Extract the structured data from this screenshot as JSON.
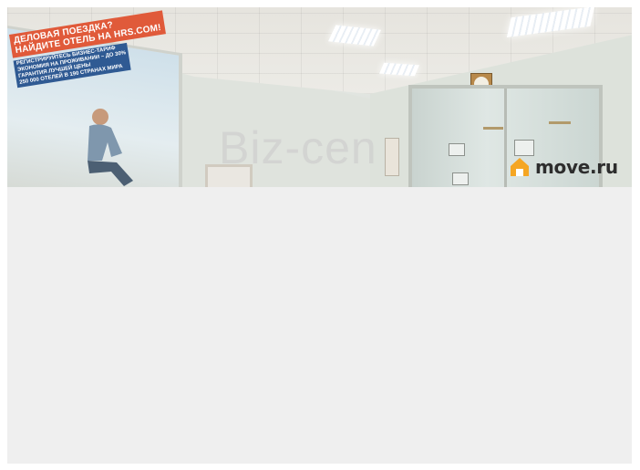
{
  "photo": {
    "poster": {
      "headline_lines": [
        "ДЕЛОВАЯ ПОЕЗДКА?",
        "НАЙДИТЕ ОТЕЛЬ НА HRS.COM!"
      ],
      "bullets": [
        "РЕГИСТРИРУЙТЕСЬ БИЗНЕС-ТАРИФ",
        "ЭКОНОМИЯ НА ПРОЖИВАНИИ – ДО 30%",
        "ГАРАНТИЯ ЛУЧШЕЙ ЦЕНЫ",
        "250 000 ОТЕЛЕЙ В 190 СТРАНАХ МИРА"
      ]
    },
    "watermark": "Biz-cen",
    "logo": {
      "text": "move.ru",
      "icon": "house-icon",
      "accent": "#f5a623"
    }
  },
  "colors": {
    "viewer_background": "#efefef",
    "poster_red": "#e05a3a",
    "poster_blue": "#2f5a93"
  }
}
